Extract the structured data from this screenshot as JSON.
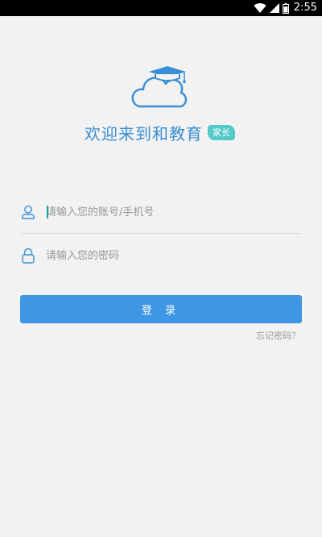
{
  "status_bar": {
    "time": "2:55"
  },
  "welcome": {
    "title": "欢迎来到和教育",
    "badge": "家长"
  },
  "account": {
    "placeholder": "请输入您的账号/手机号"
  },
  "password": {
    "placeholder": "请输入您的密码"
  },
  "login_button": {
    "label": "登 录"
  },
  "forgot_password": {
    "label": "忘记密码？"
  },
  "colors": {
    "brand": "#3a8fd4",
    "button": "#3d97e2",
    "badge": "#55c9c9",
    "background": "#f2f2f2"
  },
  "icons": [
    "wifi-icon",
    "signal-icon",
    "battery-icon",
    "graduation-cloud-logo",
    "user-icon",
    "lock-icon"
  ]
}
